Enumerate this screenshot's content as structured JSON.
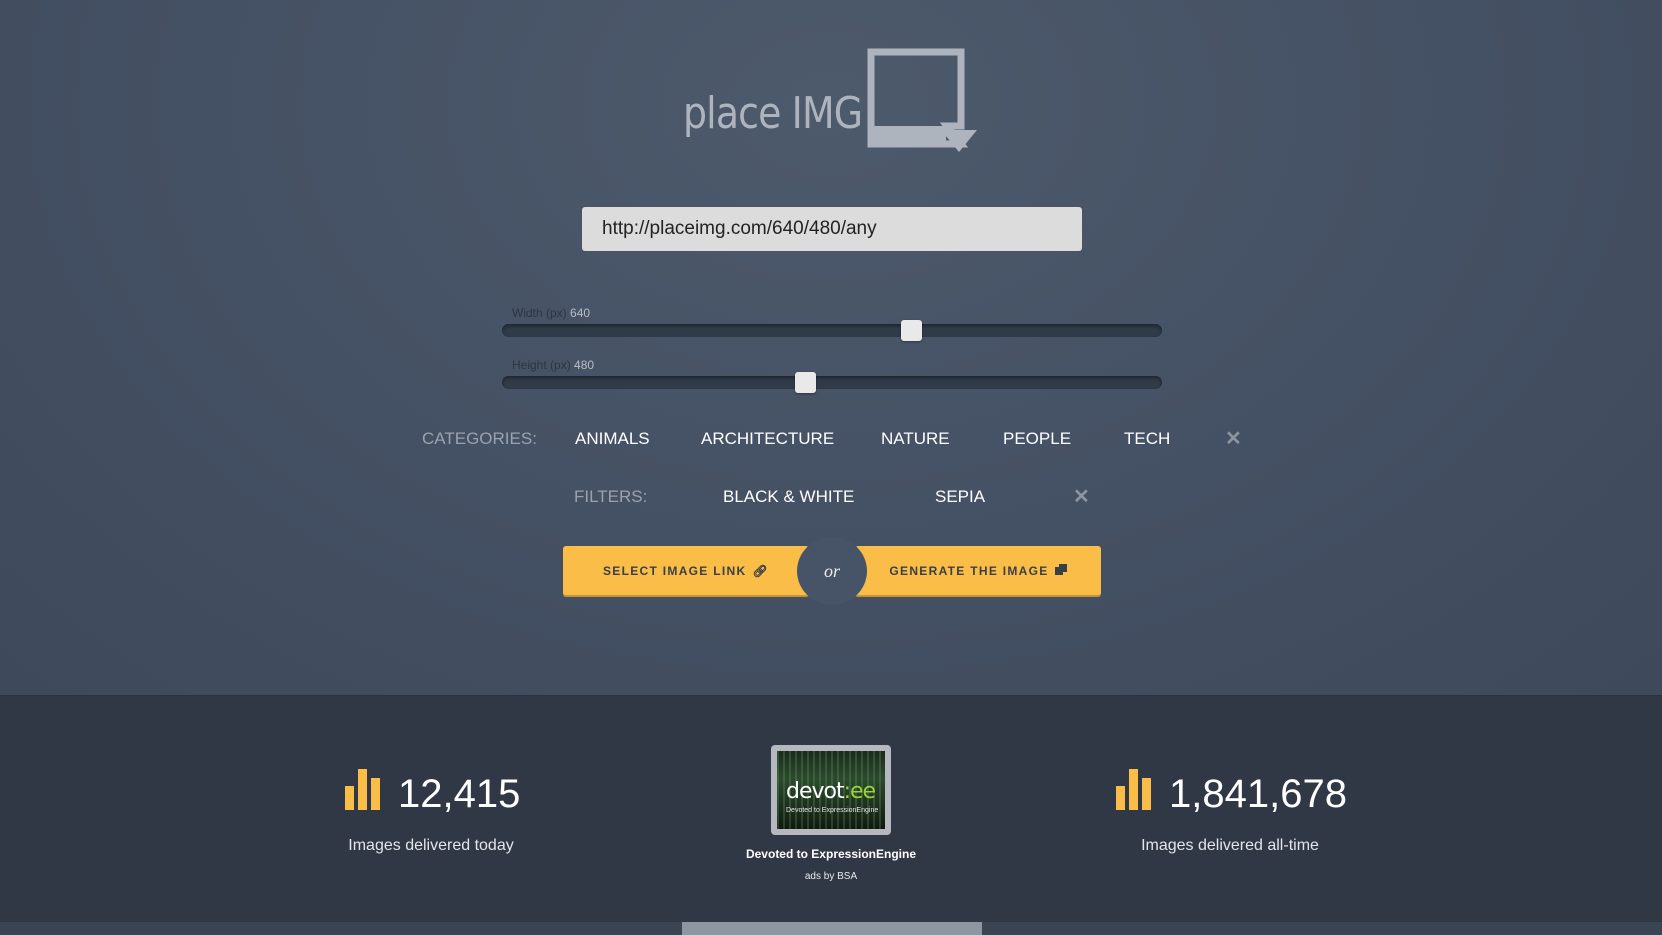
{
  "logo": {
    "text": "place IMG",
    "icon": "placeimg-logo-icon"
  },
  "url_field": {
    "value": "http://placeimg.com/640/480/any"
  },
  "width_slider": {
    "label": "Width (px)",
    "value": "640",
    "fraction": 0.62
  },
  "height_slider": {
    "label": "Height (px)",
    "value": "480",
    "fraction": 0.46
  },
  "categories": {
    "label": "CATEGORIES:",
    "items": [
      "ANIMALS",
      "ARCHITECTURE",
      "NATURE",
      "PEOPLE",
      "TECH"
    ],
    "clear_icon": "close-icon"
  },
  "filters": {
    "label": "FILTERS:",
    "items": [
      "BLACK & WHITE",
      "SEPIA"
    ],
    "clear_icon": "close-icon"
  },
  "actions": {
    "select_link_label": "SELECT IMAGE LINK",
    "select_link_icon": "link-icon",
    "or_text": "or",
    "generate_label": "GENERATE THE IMAGE",
    "generate_icon": "copy-icon"
  },
  "stats": {
    "today_value": "12,415",
    "today_caption": "Images delivered today",
    "alltime_value": "1,841,678",
    "alltime_caption": "Images delivered all-time",
    "icon": "bar-chart-icon"
  },
  "ad": {
    "logo_text_a": "devot",
    "logo_text_b": ":ee",
    "logo_sub": "Devoted to ExpressionEngine",
    "caption": "Devoted to ExpressionEngine",
    "credit": "ads by BSA"
  },
  "colors": {
    "accent": "#f9bd48",
    "background": "#445063",
    "footer": "#303846"
  }
}
